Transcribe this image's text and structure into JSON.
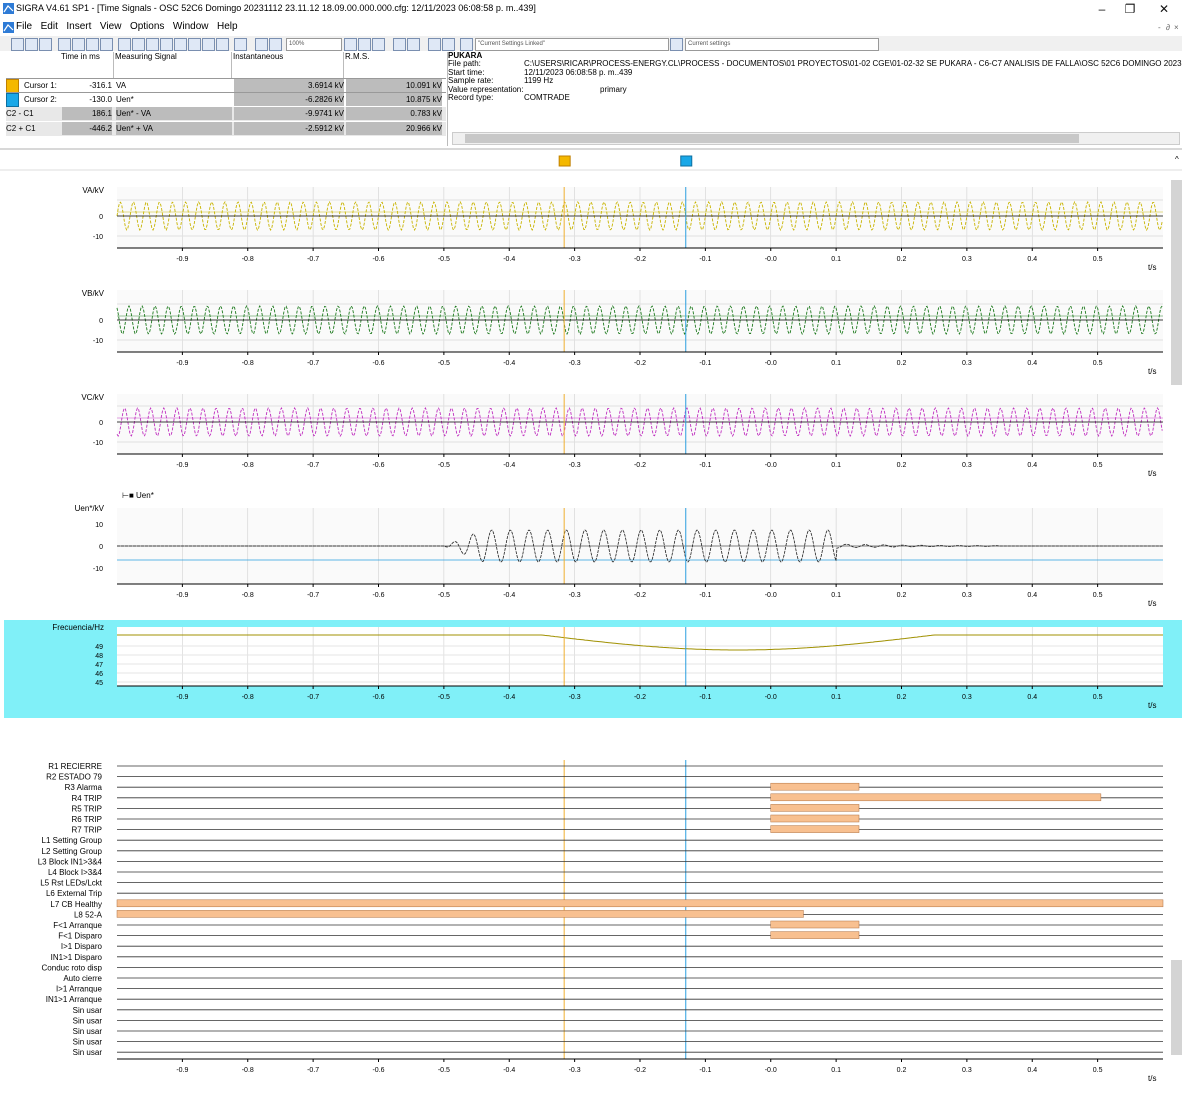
{
  "window": {
    "title": "SIGRA V4.61 SP1 - [Time Signals - OSC 52C6  Domingo 20231112 23.11.12 18.09.00.000.000.cfg: 12/11/2023 06:08:58 p. m..439]",
    "controls": [
      "–",
      "❐",
      "✕"
    ],
    "sub_controls": [
      "-",
      "∂",
      "×"
    ]
  },
  "menu": [
    "File",
    "Edit",
    "Insert",
    "View",
    "Options",
    "Window",
    "Help"
  ],
  "toolbar": {
    "zoom_combo": "100%",
    "combo_a": "\"Current Settings Linked\"",
    "combo_b": "Current settings"
  },
  "cursor_table": {
    "headers": [
      "Time in ms",
      "Measuring Signal",
      "Instantaneous",
      "R.M.S."
    ],
    "rows": [
      {
        "label": "Cursor 1:",
        "swatch": "#f4b800",
        "time": "-316.1",
        "signal": "VA",
        "inst": "3.6914 kV",
        "rms": "10.091 kV"
      },
      {
        "label": "Cursor 2:",
        "swatch": "#19a8e8",
        "time": "-130.0",
        "signal": "Uen*",
        "inst": "-6.2826 kV",
        "rms": "10.875 kV"
      },
      {
        "label": "C2 - C1",
        "swatch": "",
        "time": "186.1",
        "signal": "Uen* - VA",
        "inst": "-9.9741 kV",
        "rms": "0.783 kV"
      },
      {
        "label": "C2 + C1",
        "swatch": "",
        "time": "-446.2",
        "signal": "Uen* + VA",
        "inst": "-2.5912 kV",
        "rms": "20.966 kV"
      }
    ]
  },
  "info": {
    "station": "PUKARA",
    "fields": [
      {
        "k": "File path:",
        "v": "C:\\USERS\\RICAR\\PROCESS-ENERGY.CL\\PROCESS - DOCUMENTOS\\01 PROYECTOS\\01-02 CGE\\01-02-32 SE PUKARA - C6-C7 ANALISIS DE FALLA\\OSC 52C6  DOMINGO 20231112"
      },
      {
        "k": "Start time:",
        "v": "12/11/2023 06:08:58 p. m..439"
      },
      {
        "k": "Sample rate:",
        "v": "1199 Hz"
      },
      {
        "k": "Value representation:",
        "v": "primary"
      },
      {
        "k": "Record type:",
        "v": "COMTRADE"
      }
    ]
  },
  "x_axis": {
    "unit": "t/s",
    "ticks": [
      "-0.9",
      "-0.8",
      "-0.7",
      "-0.6",
      "-0.5",
      "-0.4",
      "-0.3",
      "-0.2",
      "-0.1",
      "-0.0",
      "0.1",
      "0.2",
      "0.3",
      "0.4",
      "0.5"
    ],
    "range": [
      -1.0,
      0.6
    ]
  },
  "cursors": {
    "c1_time": -0.316,
    "c2_time": -0.13,
    "c1_color": "#f0b030",
    "c2_color": "#2a9fe0"
  },
  "analog": [
    {
      "label": "VA/kV",
      "color": "#c8b400",
      "ticks": [
        "0",
        "-10"
      ]
    },
    {
      "label": "VB/kV",
      "color": "#1e7a1e",
      "ticks": [
        "0",
        "-10"
      ]
    },
    {
      "label": "VC/kV",
      "color": "#c030c0",
      "ticks": [
        "0",
        "-10"
      ]
    },
    {
      "label": "Uen*/kV",
      "legend": "Uen*",
      "color": "#222222",
      "ticks": [
        "10",
        "0",
        "-10"
      ]
    }
  ],
  "freq": {
    "label": "Frecuencia/Hz",
    "ticks": [
      "49",
      "48",
      "47",
      "46",
      "45"
    ],
    "color": "#a09000",
    "bg": "#80f0f8"
  },
  "binary": {
    "signals": [
      "R1 RECIERRE",
      "R2 ESTADO 79",
      "R3 Alarma",
      "R4 TRIP",
      "R5 TRIP",
      "R6 TRIP",
      "R7 TRIP",
      "L1 Setting Group",
      "L2 Setting Group",
      "L3 Block IN1>3&4",
      "L4 Block I>3&4",
      "L5 Rst LEDs/Lckt",
      "L6 External Trip",
      "L7 CB Healthy",
      "L8 52-A",
      "F<1 Arranque",
      "F<1 Disparo",
      "I>1 Disparo",
      "IN1>1 Disparo",
      "Conduc roto disp",
      "Auto cierre",
      "I>1 Arranque",
      "IN1>1 Arranque",
      "Sin usar",
      "Sin usar",
      "Sin usar",
      "Sin usar",
      "Sin usar"
    ],
    "active": [
      {
        "signal": 2,
        "start": 0.0,
        "end": 0.135
      },
      {
        "signal": 3,
        "start": 0.0,
        "end": 0.505
      },
      {
        "signal": 4,
        "start": 0.0,
        "end": 0.135
      },
      {
        "signal": 5,
        "start": 0.0,
        "end": 0.135
      },
      {
        "signal": 6,
        "start": 0.0,
        "end": 0.135
      },
      {
        "signal": 13,
        "start": -1.0,
        "end": 0.6
      },
      {
        "signal": 14,
        "start": -1.0,
        "end": 0.05
      },
      {
        "signal": 15,
        "start": 0.0,
        "end": 0.135
      },
      {
        "signal": 16,
        "start": 0.0,
        "end": 0.135
      }
    ],
    "bar_color": "#f8c090"
  }
}
